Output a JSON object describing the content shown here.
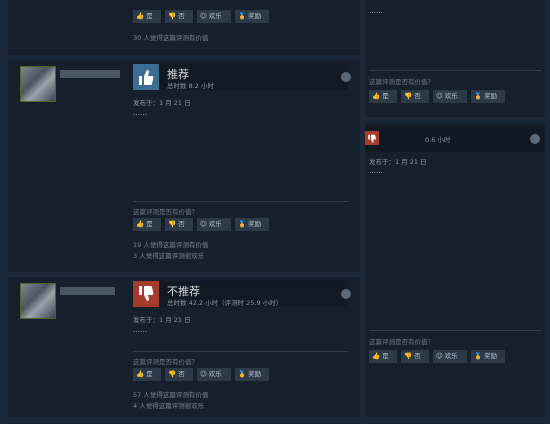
{
  "buttons": {
    "yes": "是",
    "no": "否",
    "funny": "欢乐",
    "award": "奖励",
    "helpful_q": "这篇评测是否有价值？"
  },
  "review1": {
    "stat1": "30 人觉得这篇评测有价值"
  },
  "review2": {
    "vote": "推荐",
    "hours": "总时数 8.2 小时",
    "posted": "发布于：1 月 21 日",
    "body": "……",
    "stat1": "19 人觉得这篇评测有价值",
    "stat2": "3 人觉得这篇评测很欢乐"
  },
  "review3": {
    "vote": "不推荐",
    "hours": "总时数 42.2 小时（评测时 25.9 小时）",
    "posted": "发布于：1 月 21 日",
    "body": "……",
    "stat1": "57 人觉得这篇评测有价值",
    "stat2": "4 人觉得这篇评测很欢乐"
  },
  "right1": {
    "body": "……"
  },
  "right2": {
    "hours": "0.6 小时",
    "posted": "发布于：1 月 21 日",
    "body": "……",
    "stat1": "",
    "stat2": ""
  },
  "colors": {
    "bg": "#1b2838",
    "card": "#16202d",
    "recommend": "#3b6e95",
    "notrecommend": "#a73b2b"
  },
  "icons": [
    "thumbs-up-icon",
    "thumbs-down-icon",
    "smile-icon",
    "award-icon",
    "steam-logo-icon"
  ]
}
